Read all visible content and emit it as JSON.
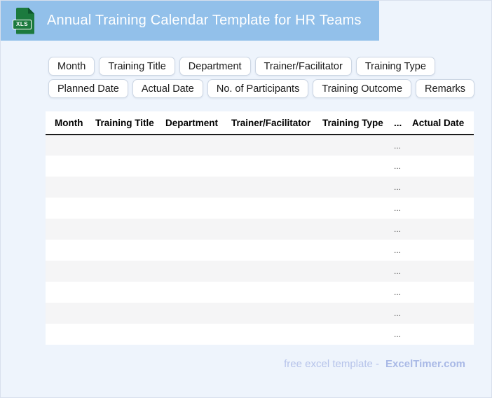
{
  "header": {
    "title": "Annual Training Calendar Template for HR Teams",
    "file_badge": "XLS"
  },
  "chips": [
    "Month",
    "Training Title",
    "Department",
    "Trainer/Facilitator",
    "Training Type",
    "Planned Date",
    "Actual Date",
    "No. of Participants",
    "Training Outcome",
    "Remarks"
  ],
  "table": {
    "columns": [
      "Month",
      "Training Title",
      "Department",
      "Trainer/Facilitator",
      "Training Type",
      "...",
      "Actual Date"
    ],
    "ellipsis_column_index": 5,
    "rows": [
      [
        "",
        "",
        "",
        "",
        "",
        "...",
        ""
      ],
      [
        "",
        "",
        "",
        "",
        "",
        "...",
        ""
      ],
      [
        "",
        "",
        "",
        "",
        "",
        "...",
        ""
      ],
      [
        "",
        "",
        "",
        "",
        "",
        "...",
        ""
      ],
      [
        "",
        "",
        "",
        "",
        "",
        "...",
        ""
      ],
      [
        "",
        "",
        "",
        "",
        "",
        "...",
        ""
      ],
      [
        "",
        "",
        "",
        "",
        "",
        "...",
        ""
      ],
      [
        "",
        "",
        "",
        "",
        "",
        "...",
        ""
      ],
      [
        "",
        "",
        "",
        "",
        "",
        "...",
        ""
      ],
      [
        "",
        "",
        "",
        "",
        "",
        "...",
        ""
      ]
    ]
  },
  "footer": {
    "text": "free excel template -",
    "brand": "ExcelTimer.com"
  },
  "colors": {
    "banner_bg": "#92c0ea",
    "icon_green": "#1c7a3e",
    "page_bg": "#eef4fc",
    "row_alt": "#f5f5f6",
    "footer_text": "#b6c3ea",
    "footer_brand": "#a9b9e6"
  }
}
